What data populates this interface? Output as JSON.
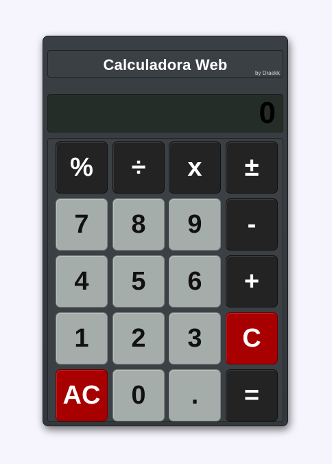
{
  "header": {
    "title": "Calculadora Web",
    "byline": "by Draekk"
  },
  "display": {
    "value": "0"
  },
  "keys": {
    "percent": "%",
    "divide": "÷",
    "multiply": "x",
    "plus_minus": "±",
    "seven": "7",
    "eight": "8",
    "nine": "9",
    "minus": "-",
    "four": "4",
    "five": "5",
    "six": "6",
    "plus": "+",
    "one": "1",
    "two": "2",
    "three": "3",
    "clear": "C",
    "all_clear": "AC",
    "zero": "0",
    "decimal": ".",
    "equals": "="
  },
  "colors": {
    "body_bg": "#3a3f44",
    "display_bg": "#252d28",
    "operator_key": "#232323",
    "digit_key": "#a4adaa",
    "clear_key": "#a80000"
  }
}
